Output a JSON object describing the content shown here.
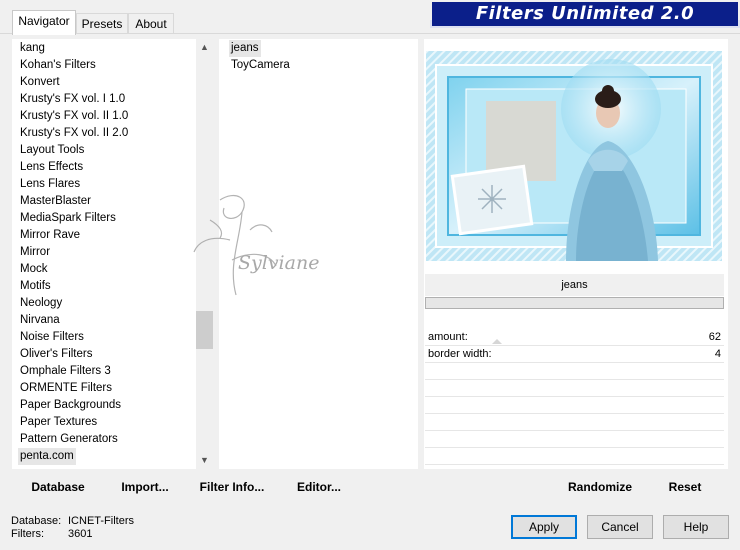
{
  "window": {
    "banner_title": "Filters Unlimited 2.0",
    "tabs": [
      "Navigator",
      "Presets",
      "About"
    ]
  },
  "categories": {
    "items": [
      "kang",
      "Kohan's Filters",
      "Konvert",
      "Krusty's FX vol. I 1.0",
      "Krusty's FX vol. II 1.0",
      "Krusty's FX vol. II 2.0",
      "Layout Tools",
      "Lens Effects",
      "Lens Flares",
      "MasterBlaster",
      "MediaSpark Filters",
      "Mirror Rave",
      "Mirror",
      "Mock",
      "Motifs",
      "Neology",
      "Nirvana",
      "Noise Filters",
      "Oliver's Filters",
      "Omphale Filters 3",
      "ORMENTE Filters",
      "Paper Backgrounds",
      "Paper Textures",
      "Pattern Generators",
      "penta.com"
    ],
    "selected": "penta.com"
  },
  "filters": {
    "items": [
      "jeans",
      "ToyCamera"
    ],
    "selected": "jeans"
  },
  "preview": {
    "filter_name": "jeans",
    "watermark_text": "Sylviane"
  },
  "parameters": [
    {
      "label": "amount:",
      "value": "62"
    },
    {
      "label": "border width:",
      "value": "4"
    }
  ],
  "toolbar": {
    "database": "Database",
    "import": "Import...",
    "filter_info": "Filter Info...",
    "editor": "Editor...",
    "randomize": "Randomize",
    "reset": "Reset"
  },
  "status": {
    "database_label": "Database:",
    "database_value": "ICNET-Filters",
    "filters_label": "Filters:",
    "filters_value": "3601"
  },
  "dialog_buttons": {
    "apply": "Apply",
    "cancel": "Cancel",
    "help": "Help"
  },
  "colors": {
    "banner": "#0b1f8a",
    "focus": "#0078d7"
  }
}
